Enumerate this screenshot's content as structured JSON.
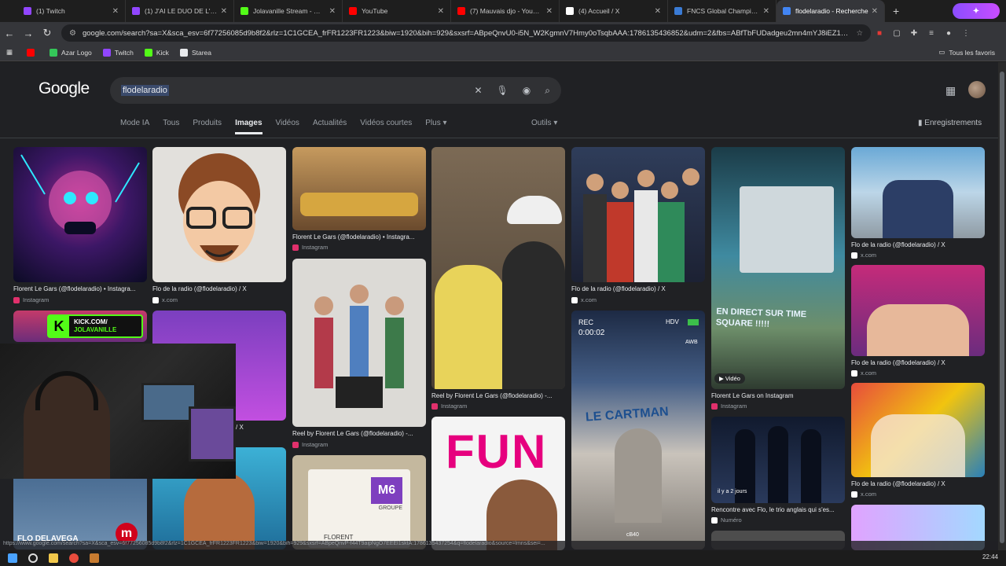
{
  "tabs": [
    {
      "title": "(1) Twitch",
      "color": "#9146ff"
    },
    {
      "title": "(1) J'AI LE DUO DE L'ANN",
      "color": "#9146ff"
    },
    {
      "title": "Jolavanille Stream - Watc",
      "color": "#53fc18"
    },
    {
      "title": "YouTube",
      "color": "#ff0000"
    },
    {
      "title": "(7) Mauvais djo - YouTube",
      "color": "#ff0000"
    },
    {
      "title": "(4) Accueil / X",
      "color": "#ffffff"
    },
    {
      "title": "FNCS Global Championsh",
      "color": "#3a7bd5"
    },
    {
      "title": "flodelaradio - Recherche",
      "color": "#4285f4"
    }
  ],
  "url": "google.com/search?sa=X&sca_esv=6f77256085d9b8f2&rlz=1C1GCEA_frFR1223FR1223&biw=1920&bih=929&sxsrf=ABpeQnvU0-i5N_W2KgmnV7Hmy0oTsqbAAA:1786135436852&udm=2&fbs=ABfTbFUDadgeu2mn4mYJ8iEZ1GUDVGqy...",
  "bookmarks": [
    {
      "label": "",
      "color": "#ff0000"
    },
    {
      "label": "Azar Logo",
      "color": "#34c759"
    },
    {
      "label": "Twitch",
      "color": "#9146ff"
    },
    {
      "label": "Kick",
      "color": "#53fc18"
    },
    {
      "label": "Starea",
      "color": "#e8eaed"
    }
  ],
  "bookmarks_right": "Tous les favoris",
  "google": {
    "logo": "Google",
    "query": "flodelaradio",
    "nav": [
      "Mode IA",
      "Tous",
      "Produits",
      "Images",
      "Vidéos",
      "Actualités",
      "Vidéos courtes",
      "Plus ▾"
    ],
    "tools": "Outils ▾",
    "saved": "Enregistrements"
  },
  "results": [
    {
      "caption": "Florent Le Gars (@flodelaradio) • Instagra...",
      "source": "Instagram",
      "src_color": "#e1306c"
    },
    {
      "caption": "Flo de la radio (@flodelaradio) / X",
      "source": "x.com",
      "src_color": "#ffffff"
    },
    {
      "caption": "Florent Le Gars (@flodelaradio) • Instagra...",
      "source": "Instagram",
      "src_color": "#e1306c"
    },
    {
      "caption": "Reel by Florent Le Gars (@flodelaradio) -...",
      "source": "Instagram",
      "src_color": "#e1306c"
    },
    {
      "caption": "Reel by Florent Le Gars (@flodelaradio) -...",
      "source": "Instagram",
      "src_color": "#e1306c"
    },
    {
      "caption": "Flo de la radio (@flodelaradio) / X",
      "source": "x.com",
      "src_color": "#ffffff"
    },
    {
      "caption": "Florent Le Gars on Instagram",
      "source": "Instagram",
      "src_color": "#e1306c"
    },
    {
      "caption": "Flo de la radio (@flodelaradio) / X",
      "source": "x.com",
      "src_color": "#ffffff"
    },
    {
      "caption": "Flo de la radio (@flodelaradio) / X",
      "source": "x.com",
      "src_color": "#ffffff"
    },
    {
      "caption": "Rencontre avec Flo, le trio anglais qui s'es...",
      "source": "Numéro",
      "src_color": "#ffffff"
    },
    {
      "caption": "Flo de la radio (@flodelaradio) / X",
      "source": "x.com",
      "src_color": "#ffffff"
    },
    {
      "caption": "Flo de la radio (@flodelaradio) / X",
      "source": "x.com",
      "src_color": "#ffffff"
    }
  ],
  "overlay_text": {
    "kick_brand": "KICK.COM/",
    "kick_user": "JOLAVANILLE",
    "video_badge": "Vidéo",
    "age_badge": "il y a 2 jours",
    "rec_label": "REC",
    "rec_time": "0:00:02",
    "hdv": "HDV",
    "sign_text": "EN DIRECT SUR TIME SQUARE !!!!!",
    "cartman": "LE CARTMAN",
    "flo_delavega": "FLO DELAVEGA",
    "m6": "M6",
    "groupe": "GROUPE",
    "florent": "FLORENT",
    "fun": "FUN",
    "awb": "AWB",
    "cb": "cB40",
    "xcom_side": "/ X"
  },
  "status_url": "https://www.google.com/search?sa=X&sca_esv=6f77256085d9b8f2&rlz=1C1GCEA_frFR1223FR1223&biw=1920&bih=929&sxsrf=ABpeQnvP-f44T9aipNgO7EEEl1sktA:1786135437254&q=flodelaradio&source=lmns&sei=...",
  "clock": "22:44"
}
